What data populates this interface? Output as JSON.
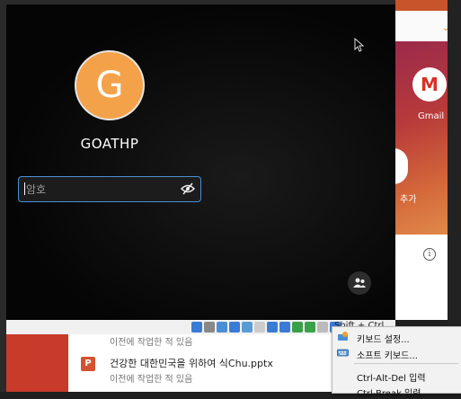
{
  "background_app": {
    "shortcut_gmail_label": "Gmail",
    "shortcut_add_label": "추가",
    "info_glyph": "i",
    "recent_files": [
      {
        "name": "",
        "subtitle": "이전에 작업한 적 있음"
      },
      {
        "name": "건강한 대한민국을 위하여 식Chu.pptx",
        "subtitle": "이전에 작업한 적 있음",
        "icon_letter": "P"
      }
    ]
  },
  "login": {
    "avatar_letter": "G",
    "username": "GOATHP",
    "password_placeholder": "암호",
    "password_value": ""
  },
  "statusbar": {
    "host_key": "Shift + Ctrl",
    "icon_colors": [
      "#3a7bd5",
      "#888",
      "#4a8fd6",
      "#3a7bd5",
      "#5b9bd5",
      "#ccc",
      "#3a7bd5",
      "#3a7bd5",
      "#3aa04a",
      "#3aa04a",
      "#bbb",
      "#3a7bd5"
    ]
  },
  "context_menu": {
    "items": [
      {
        "label": "키보드 설정...",
        "icon": "keyboard-settings-icon"
      },
      {
        "label": "소프트 키보드...",
        "icon": "soft-keyboard-icon"
      },
      {
        "label": "Ctrl-Alt-Del 입력",
        "icon": ""
      },
      {
        "label": "Ctrl-Break 입력",
        "icon": ""
      }
    ]
  },
  "colors": {
    "avatar_bg": "#f4a24a",
    "focus_blue": "#4a8fd6",
    "ppt_red": "#d35230"
  }
}
